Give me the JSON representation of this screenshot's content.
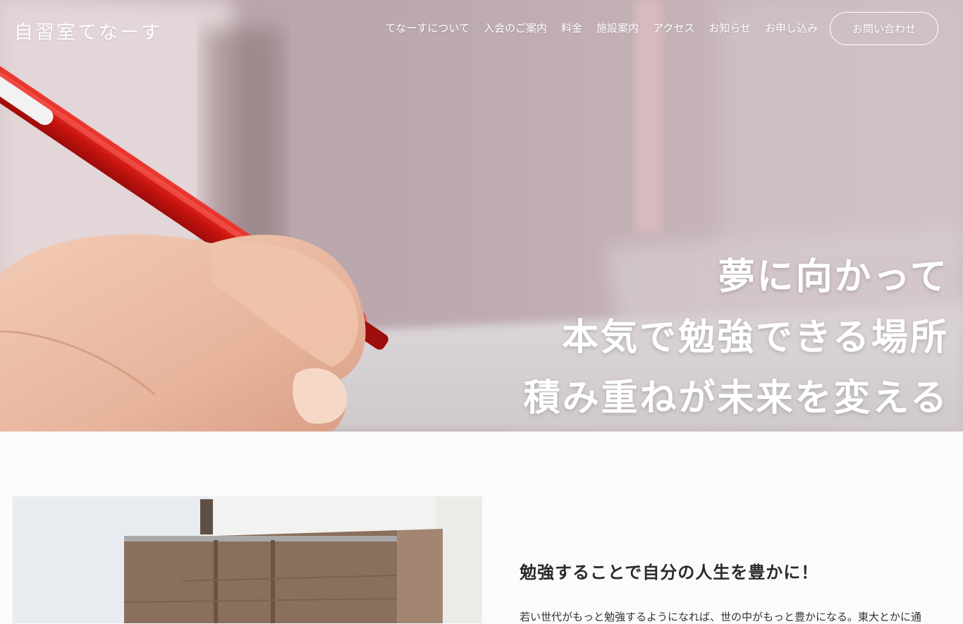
{
  "site": {
    "logo": "自習室てなーす"
  },
  "nav": {
    "items": [
      {
        "label": "てなーすについて"
      },
      {
        "label": "入会のご案内"
      },
      {
        "label": "料金"
      },
      {
        "label": "施設案内"
      },
      {
        "label": "アクセス"
      },
      {
        "label": "お知らせ"
      },
      {
        "label": "お申し込み"
      }
    ],
    "contact_button": "お問い合わせ"
  },
  "hero": {
    "lines": [
      "夢に向かって",
      "本気で勉強できる場所",
      "積み重ねが未来を変える"
    ]
  },
  "about": {
    "heading": "勉強することで自分の人生を豊かに！",
    "text": "若い世代がもっと勉強するようになれば、世の中がもっと豊かになる。東大とかに通"
  },
  "colors": {
    "pen_red": "#d31a1a",
    "text_dark": "#2b2b2b",
    "background": "#fbfbfc"
  }
}
